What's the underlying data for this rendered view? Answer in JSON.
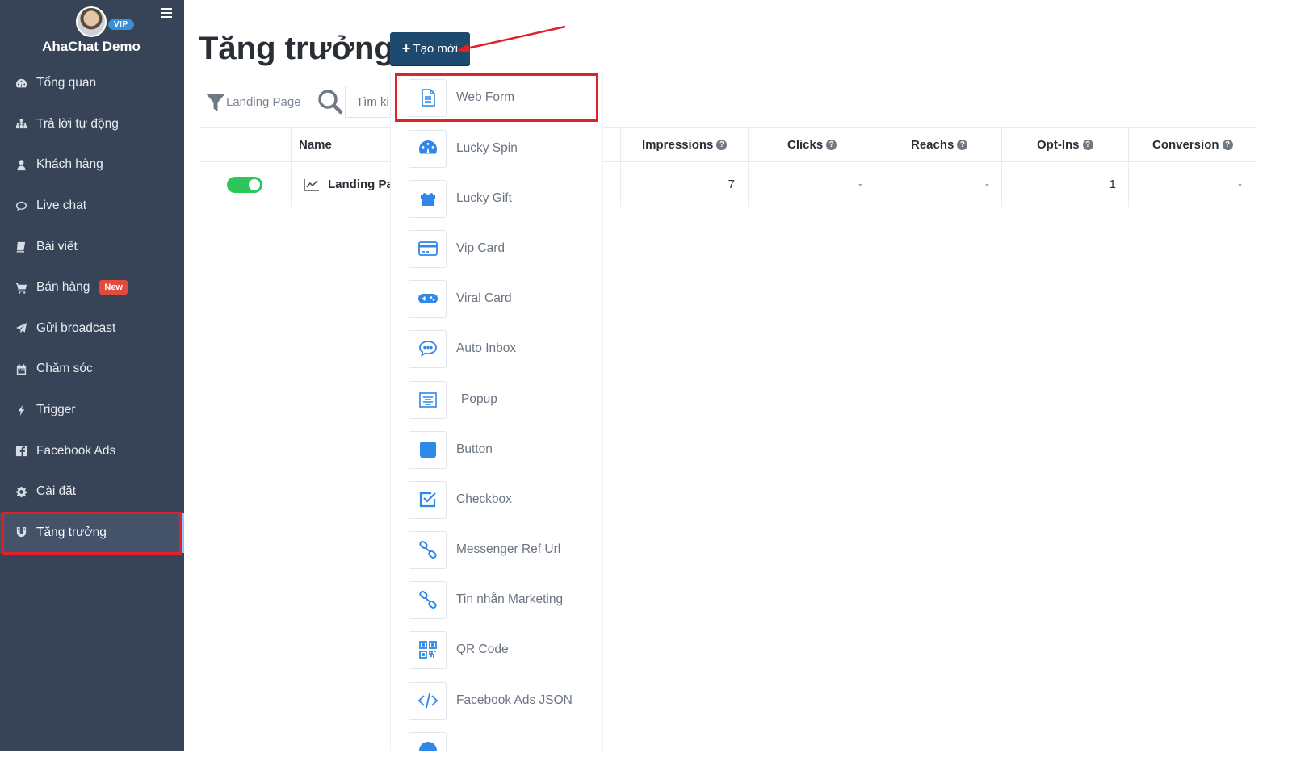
{
  "sidebar": {
    "app_name": "AhaChat Demo",
    "vip_badge": "VIP",
    "items": [
      {
        "label": "Tổng quan",
        "icon": "dashboard-icon"
      },
      {
        "label": "Trả lời tự động",
        "icon": "sitemap-icon"
      },
      {
        "label": "Khách hàng",
        "icon": "user-icon"
      },
      {
        "label": "Live chat",
        "icon": "comment-icon"
      },
      {
        "label": "Bài viết",
        "icon": "book-icon"
      },
      {
        "label": "Bán hàng",
        "icon": "cart-icon",
        "badge": "New"
      },
      {
        "label": "Gửi broadcast",
        "icon": "paper-plane-icon"
      },
      {
        "label": "Chăm sóc",
        "icon": "calendar-icon"
      },
      {
        "label": "Trigger",
        "icon": "bolt-icon"
      },
      {
        "label": "Facebook Ads",
        "icon": "facebook-icon"
      },
      {
        "label": "Cài đặt",
        "icon": "gear-icon"
      },
      {
        "label": "Tăng trưởng",
        "icon": "magnet-icon",
        "active": true
      }
    ]
  },
  "header": {
    "title": "Tăng trưởng",
    "create_button": "Tạo mới"
  },
  "filter": {
    "label": "Landing Page",
    "search_placeholder": "Tìm ki"
  },
  "table": {
    "columns": [
      "Name",
      "Impressions",
      "Clicks",
      "Reachs",
      "Opt-Ins",
      "Conversion"
    ],
    "rows": [
      {
        "name": "Landing Pa",
        "impressions": "7",
        "clicks": "-",
        "reachs": "-",
        "optins": "1",
        "conversion": "-"
      }
    ]
  },
  "dropdown": {
    "items": [
      {
        "label": "Web Form",
        "icon": "file-icon"
      },
      {
        "label": "Lucky Spin",
        "icon": "gauge-icon"
      },
      {
        "label": "Lucky Gift",
        "icon": "gift-icon"
      },
      {
        "label": "Vip Card",
        "icon": "credit-card-icon"
      },
      {
        "label": "Viral Card",
        "icon": "gamepad-icon"
      },
      {
        "label": "Auto Inbox",
        "icon": "chat-bubble-icon"
      },
      {
        "label": "Popup",
        "icon": "popup-icon"
      },
      {
        "label": "Button",
        "icon": "square-icon"
      },
      {
        "label": "Checkbox",
        "icon": "checkbox-icon"
      },
      {
        "label": "Messenger Ref Url",
        "icon": "link-icon"
      },
      {
        "label": "Tin nhắn Marketing",
        "icon": "link-icon"
      },
      {
        "label": "QR Code",
        "icon": "qrcode-icon"
      },
      {
        "label": "Facebook Ads JSON",
        "icon": "code-icon"
      }
    ]
  },
  "colors": {
    "sidebar_bg": "#374457",
    "primary_button": "#1e4a6f",
    "accent_blue": "#2f87e8",
    "toggle_on": "#2dc65a",
    "highlight_red": "#e0212a",
    "new_badge": "#e24b3c"
  }
}
